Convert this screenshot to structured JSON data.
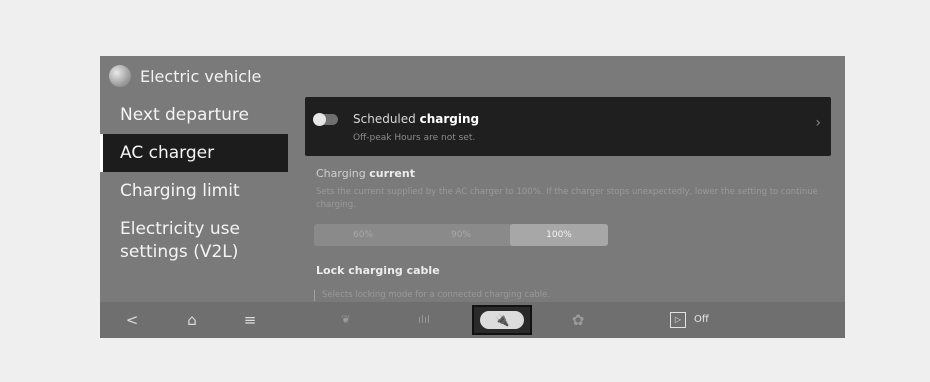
{
  "app": {
    "title": "Electric vehicle",
    "icon": "globe-icon"
  },
  "sidebar": {
    "items": [
      {
        "label": "Next departure"
      },
      {
        "label": "AC charger"
      },
      {
        "label": "Charging limit"
      },
      {
        "label": "Electricity use settings (V2L)"
      }
    ],
    "active_index": 1
  },
  "scheduled": {
    "title_prefix": "Scheduled ",
    "title_bold": "charging",
    "subtitle": "Off-peak Hours are not set.",
    "enabled": false
  },
  "charging_current": {
    "title_prefix": "Charging ",
    "title_bold": "current",
    "description": "Sets the current supplied by the AC charger to 100%. If the charger stops unexpectedly, lower the setting to continue charging.",
    "options": [
      "60%",
      "90%",
      "100%"
    ],
    "selected": "100%"
  },
  "lock_cable": {
    "title": "Lock charging cable",
    "description": "Selects locking mode for a connected charging cable."
  },
  "bottom_bar": {
    "back_glyph": "<",
    "home_glyph": "⌂",
    "menu_glyph": "≡",
    "eco_glyph": "❦",
    "stats_glyph": "ılıl",
    "charge_glyph": "🔌",
    "settings_glyph": "✿",
    "media_label": "Off"
  },
  "colors": {
    "screen_bg": "#7a7a7a",
    "active_item_bg": "#1c1c1c",
    "card_bg": "#1f1f1f"
  }
}
